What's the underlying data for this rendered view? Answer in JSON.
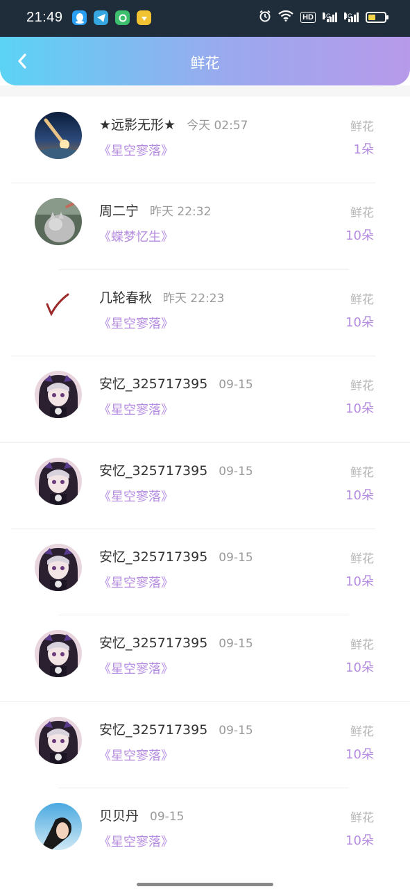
{
  "status_bar": {
    "time": "21:49",
    "apps": [
      {
        "icon": "qq-icon",
        "color": "#2a9ef2"
      },
      {
        "icon": "telegram-icon",
        "color": "#35a6e0"
      },
      {
        "icon": "green-app-icon",
        "color": "#3dbf6e"
      },
      {
        "icon": "yellow-app-icon",
        "color": "#f1c232"
      }
    ],
    "hd_label": "HD",
    "network_1": "4G",
    "network_2": "4G",
    "battery_level": 0.45
  },
  "header": {
    "title": "鲜花",
    "back_icon": "chevron-left-icon"
  },
  "records": [
    {
      "name": "★远影无形★",
      "time": "今天 02:57",
      "work": "《星空寥落》",
      "gift": "鲜花",
      "count": "1朵",
      "avatar": "meteor"
    },
    {
      "name": "周二宁",
      "time": "昨天 22:32",
      "work": "《蝶梦忆生》",
      "gift": "鲜花",
      "count": "10朵",
      "avatar": "cat"
    },
    {
      "name": "几轮春秋",
      "time": "昨天 22:23",
      "work": "《星空寥落》",
      "gift": "鲜花",
      "count": "10朵",
      "avatar": "check"
    },
    {
      "name": "安忆_325717395",
      "time": "09-15",
      "work": "《星空寥落》",
      "gift": "鲜花",
      "count": "10朵",
      "avatar": "anime"
    },
    {
      "name": "安忆_325717395",
      "time": "09-15",
      "work": "《星空寥落》",
      "gift": "鲜花",
      "count": "10朵",
      "avatar": "anime"
    },
    {
      "name": "安忆_325717395",
      "time": "09-15",
      "work": "《星空寥落》",
      "gift": "鲜花",
      "count": "10朵",
      "avatar": "anime"
    },
    {
      "name": "安忆_325717395",
      "time": "09-15",
      "work": "《星空寥落》",
      "gift": "鲜花",
      "count": "10朵",
      "avatar": "anime"
    },
    {
      "name": "安忆_325717395",
      "time": "09-15",
      "work": "《星空寥落》",
      "gift": "鲜花",
      "count": "10朵",
      "avatar": "anime"
    },
    {
      "name": "贝贝丹",
      "time": "09-15",
      "work": "《星空寥落》",
      "gift": "鲜花",
      "count": "10朵",
      "avatar": "sky"
    }
  ],
  "colors": {
    "accent": "#b58be0",
    "header_gradient_start": "#5bd3f4",
    "header_gradient_end": "#b79aea"
  }
}
